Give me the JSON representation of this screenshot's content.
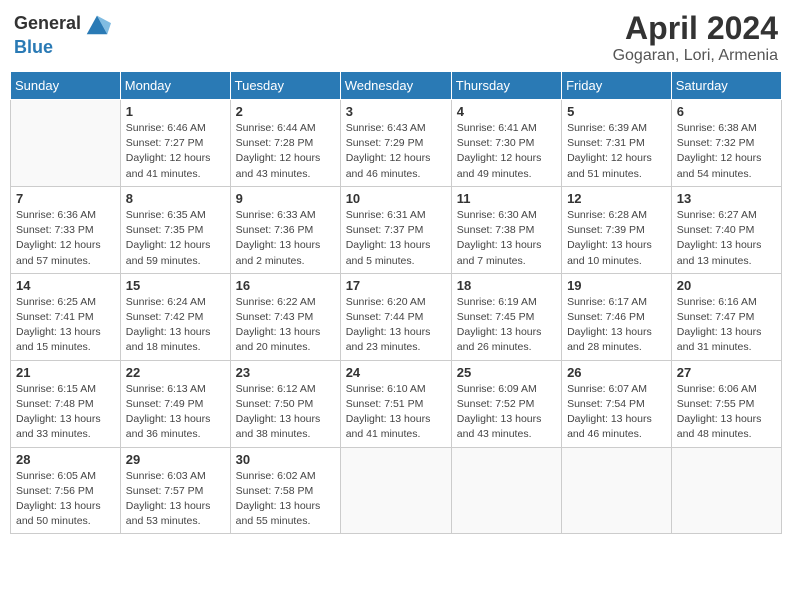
{
  "header": {
    "logo_line1": "General",
    "logo_line2": "Blue",
    "month_year": "April 2024",
    "location": "Gogaran, Lori, Armenia"
  },
  "weekdays": [
    "Sunday",
    "Monday",
    "Tuesday",
    "Wednesday",
    "Thursday",
    "Friday",
    "Saturday"
  ],
  "weeks": [
    [
      {
        "day": "",
        "sunrise": "",
        "sunset": "",
        "daylight": ""
      },
      {
        "day": "1",
        "sunrise": "Sunrise: 6:46 AM",
        "sunset": "Sunset: 7:27 PM",
        "daylight": "Daylight: 12 hours and 41 minutes."
      },
      {
        "day": "2",
        "sunrise": "Sunrise: 6:44 AM",
        "sunset": "Sunset: 7:28 PM",
        "daylight": "Daylight: 12 hours and 43 minutes."
      },
      {
        "day": "3",
        "sunrise": "Sunrise: 6:43 AM",
        "sunset": "Sunset: 7:29 PM",
        "daylight": "Daylight: 12 hours and 46 minutes."
      },
      {
        "day": "4",
        "sunrise": "Sunrise: 6:41 AM",
        "sunset": "Sunset: 7:30 PM",
        "daylight": "Daylight: 12 hours and 49 minutes."
      },
      {
        "day": "5",
        "sunrise": "Sunrise: 6:39 AM",
        "sunset": "Sunset: 7:31 PM",
        "daylight": "Daylight: 12 hours and 51 minutes."
      },
      {
        "day": "6",
        "sunrise": "Sunrise: 6:38 AM",
        "sunset": "Sunset: 7:32 PM",
        "daylight": "Daylight: 12 hours and 54 minutes."
      }
    ],
    [
      {
        "day": "7",
        "sunrise": "Sunrise: 6:36 AM",
        "sunset": "Sunset: 7:33 PM",
        "daylight": "Daylight: 12 hours and 57 minutes."
      },
      {
        "day": "8",
        "sunrise": "Sunrise: 6:35 AM",
        "sunset": "Sunset: 7:35 PM",
        "daylight": "Daylight: 12 hours and 59 minutes."
      },
      {
        "day": "9",
        "sunrise": "Sunrise: 6:33 AM",
        "sunset": "Sunset: 7:36 PM",
        "daylight": "Daylight: 13 hours and 2 minutes."
      },
      {
        "day": "10",
        "sunrise": "Sunrise: 6:31 AM",
        "sunset": "Sunset: 7:37 PM",
        "daylight": "Daylight: 13 hours and 5 minutes."
      },
      {
        "day": "11",
        "sunrise": "Sunrise: 6:30 AM",
        "sunset": "Sunset: 7:38 PM",
        "daylight": "Daylight: 13 hours and 7 minutes."
      },
      {
        "day": "12",
        "sunrise": "Sunrise: 6:28 AM",
        "sunset": "Sunset: 7:39 PM",
        "daylight": "Daylight: 13 hours and 10 minutes."
      },
      {
        "day": "13",
        "sunrise": "Sunrise: 6:27 AM",
        "sunset": "Sunset: 7:40 PM",
        "daylight": "Daylight: 13 hours and 13 minutes."
      }
    ],
    [
      {
        "day": "14",
        "sunrise": "Sunrise: 6:25 AM",
        "sunset": "Sunset: 7:41 PM",
        "daylight": "Daylight: 13 hours and 15 minutes."
      },
      {
        "day": "15",
        "sunrise": "Sunrise: 6:24 AM",
        "sunset": "Sunset: 7:42 PM",
        "daylight": "Daylight: 13 hours and 18 minutes."
      },
      {
        "day": "16",
        "sunrise": "Sunrise: 6:22 AM",
        "sunset": "Sunset: 7:43 PM",
        "daylight": "Daylight: 13 hours and 20 minutes."
      },
      {
        "day": "17",
        "sunrise": "Sunrise: 6:20 AM",
        "sunset": "Sunset: 7:44 PM",
        "daylight": "Daylight: 13 hours and 23 minutes."
      },
      {
        "day": "18",
        "sunrise": "Sunrise: 6:19 AM",
        "sunset": "Sunset: 7:45 PM",
        "daylight": "Daylight: 13 hours and 26 minutes."
      },
      {
        "day": "19",
        "sunrise": "Sunrise: 6:17 AM",
        "sunset": "Sunset: 7:46 PM",
        "daylight": "Daylight: 13 hours and 28 minutes."
      },
      {
        "day": "20",
        "sunrise": "Sunrise: 6:16 AM",
        "sunset": "Sunset: 7:47 PM",
        "daylight": "Daylight: 13 hours and 31 minutes."
      }
    ],
    [
      {
        "day": "21",
        "sunrise": "Sunrise: 6:15 AM",
        "sunset": "Sunset: 7:48 PM",
        "daylight": "Daylight: 13 hours and 33 minutes."
      },
      {
        "day": "22",
        "sunrise": "Sunrise: 6:13 AM",
        "sunset": "Sunset: 7:49 PM",
        "daylight": "Daylight: 13 hours and 36 minutes."
      },
      {
        "day": "23",
        "sunrise": "Sunrise: 6:12 AM",
        "sunset": "Sunset: 7:50 PM",
        "daylight": "Daylight: 13 hours and 38 minutes."
      },
      {
        "day": "24",
        "sunrise": "Sunrise: 6:10 AM",
        "sunset": "Sunset: 7:51 PM",
        "daylight": "Daylight: 13 hours and 41 minutes."
      },
      {
        "day": "25",
        "sunrise": "Sunrise: 6:09 AM",
        "sunset": "Sunset: 7:52 PM",
        "daylight": "Daylight: 13 hours and 43 minutes."
      },
      {
        "day": "26",
        "sunrise": "Sunrise: 6:07 AM",
        "sunset": "Sunset: 7:54 PM",
        "daylight": "Daylight: 13 hours and 46 minutes."
      },
      {
        "day": "27",
        "sunrise": "Sunrise: 6:06 AM",
        "sunset": "Sunset: 7:55 PM",
        "daylight": "Daylight: 13 hours and 48 minutes."
      }
    ],
    [
      {
        "day": "28",
        "sunrise": "Sunrise: 6:05 AM",
        "sunset": "Sunset: 7:56 PM",
        "daylight": "Daylight: 13 hours and 50 minutes."
      },
      {
        "day": "29",
        "sunrise": "Sunrise: 6:03 AM",
        "sunset": "Sunset: 7:57 PM",
        "daylight": "Daylight: 13 hours and 53 minutes."
      },
      {
        "day": "30",
        "sunrise": "Sunrise: 6:02 AM",
        "sunset": "Sunset: 7:58 PM",
        "daylight": "Daylight: 13 hours and 55 minutes."
      },
      {
        "day": "",
        "sunrise": "",
        "sunset": "",
        "daylight": ""
      },
      {
        "day": "",
        "sunrise": "",
        "sunset": "",
        "daylight": ""
      },
      {
        "day": "",
        "sunrise": "",
        "sunset": "",
        "daylight": ""
      },
      {
        "day": "",
        "sunrise": "",
        "sunset": "",
        "daylight": ""
      }
    ]
  ]
}
